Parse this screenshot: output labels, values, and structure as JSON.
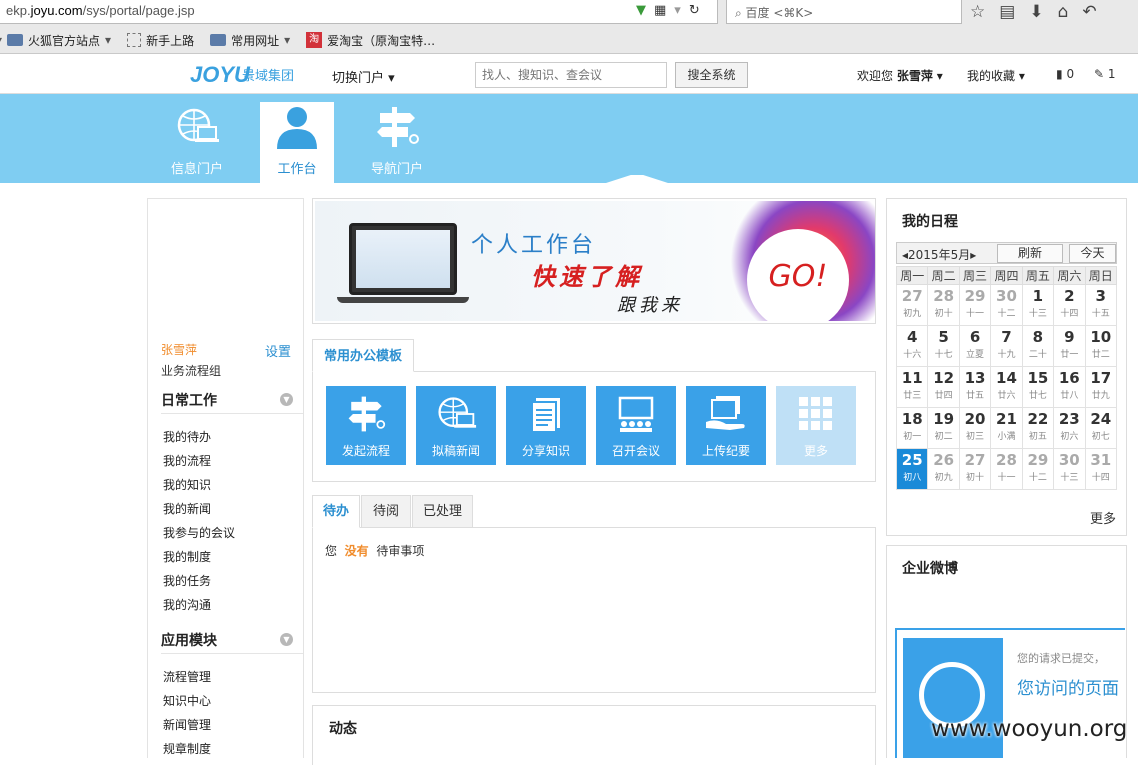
{
  "browser": {
    "url_prefix": "ekp.",
    "url_domain": "joyu.com",
    "url_path": "/sys/portal/page.jsp",
    "search_placeholder": "百度 <⌘K>",
    "bookmarks": [
      {
        "label": "火狐官方站点",
        "icon": "folder-icon",
        "has_menu": true
      },
      {
        "label": "新手上路",
        "icon": "page-icon",
        "has_menu": false
      },
      {
        "label": "常用网址",
        "icon": "folder-icon",
        "has_menu": true
      },
      {
        "label": "爱淘宝（原淘宝特…",
        "icon": "taobao-icon",
        "has_menu": false
      }
    ]
  },
  "header": {
    "logo_text": "JOYU",
    "logo_cn": "景域集团",
    "switch_portal": "切换门户",
    "search_placeholder": "找人、搜知识、查会议",
    "search_button": "搜全系统",
    "welcome_prefix": "欢迎您",
    "user_name": "张雪萍",
    "favorites": "我的收藏",
    "doc_count": "0",
    "task_count": "1"
  },
  "portal_tabs": [
    {
      "label": "信息门户",
      "icon": "globe-laptop-icon",
      "active": false
    },
    {
      "label": "工作台",
      "icon": "person-icon",
      "active": true
    },
    {
      "label": "导航门户",
      "icon": "signpost-icon",
      "active": false
    }
  ],
  "sidebar": {
    "user_name": "张雪萍",
    "settings": "设置",
    "group": "业务流程组",
    "section_daily": "日常工作",
    "daily_items": [
      "我的待办",
      "我的流程",
      "我的知识",
      "我的新闻",
      "我参与的会议",
      "我的制度",
      "我的任务",
      "我的沟通"
    ],
    "section_apps": "应用模块",
    "app_items": [
      "流程管理",
      "知识中心",
      "新闻管理",
      "规章制度"
    ]
  },
  "banner": {
    "line1": "个人工作台",
    "line2": "快速了解",
    "line3": "跟我来",
    "go": "GO!"
  },
  "templates": {
    "tab": "常用办公模板",
    "tiles": [
      {
        "label": "发起流程",
        "icon": "signpost-icon"
      },
      {
        "label": "拟稿新闻",
        "icon": "globe-laptop-icon"
      },
      {
        "label": "分享知识",
        "icon": "document-icon"
      },
      {
        "label": "召开会议",
        "icon": "meeting-icon"
      },
      {
        "label": "上传纪要",
        "icon": "upload-minutes-icon"
      },
      {
        "label": "更多",
        "icon": "grid-icon"
      }
    ]
  },
  "todo": {
    "tabs": [
      "待办",
      "待阅",
      "已处理"
    ],
    "active_tab": 0,
    "msg_prefix": "您",
    "msg_highlight": "没有",
    "msg_suffix": "待审事项"
  },
  "dynamics": {
    "title": "动态"
  },
  "schedule": {
    "title": "我的日程",
    "month": "2015年5月",
    "refresh": "刷新",
    "today": "今天",
    "weekdays": [
      "周一",
      "周二",
      "周三",
      "周四",
      "周五",
      "周六",
      "周日"
    ],
    "weeks": [
      [
        [
          "27",
          "初九",
          true
        ],
        [
          "28",
          "初十",
          true
        ],
        [
          "29",
          "十一",
          true
        ],
        [
          "30",
          "十二",
          true
        ],
        [
          "1",
          "十三",
          false
        ],
        [
          "2",
          "十四",
          false
        ],
        [
          "3",
          "十五",
          false
        ]
      ],
      [
        [
          "4",
          "十六",
          false
        ],
        [
          "5",
          "十七",
          false
        ],
        [
          "6",
          "立夏",
          false
        ],
        [
          "7",
          "十九",
          false
        ],
        [
          "8",
          "二十",
          false
        ],
        [
          "9",
          "廿一",
          false
        ],
        [
          "10",
          "廿二",
          false
        ]
      ],
      [
        [
          "11",
          "廿三",
          false
        ],
        [
          "12",
          "廿四",
          false
        ],
        [
          "13",
          "廿五",
          false
        ],
        [
          "14",
          "廿六",
          false
        ],
        [
          "15",
          "廿七",
          false
        ],
        [
          "16",
          "廿八",
          false
        ],
        [
          "17",
          "廿九",
          false
        ]
      ],
      [
        [
          "18",
          "初一",
          false
        ],
        [
          "19",
          "初二",
          false
        ],
        [
          "20",
          "初三",
          false
        ],
        [
          "21",
          "小满",
          false
        ],
        [
          "22",
          "初五",
          false
        ],
        [
          "23",
          "初六",
          false
        ],
        [
          "24",
          "初七",
          false
        ]
      ],
      [
        [
          "25",
          "初八",
          false
        ],
        [
          "26",
          "初九",
          true
        ],
        [
          "27",
          "初十",
          true
        ],
        [
          "28",
          "十一",
          true
        ],
        [
          "29",
          "十二",
          true
        ],
        [
          "30",
          "十三",
          true
        ],
        [
          "31",
          "十四",
          true
        ]
      ]
    ],
    "today_date": "25",
    "more": "更多"
  },
  "weibo": {
    "title": "企业微博",
    "notice1": "您的请求已提交，",
    "notice2": "您访问的页面"
  },
  "watermark": "www.wooyun.org"
}
